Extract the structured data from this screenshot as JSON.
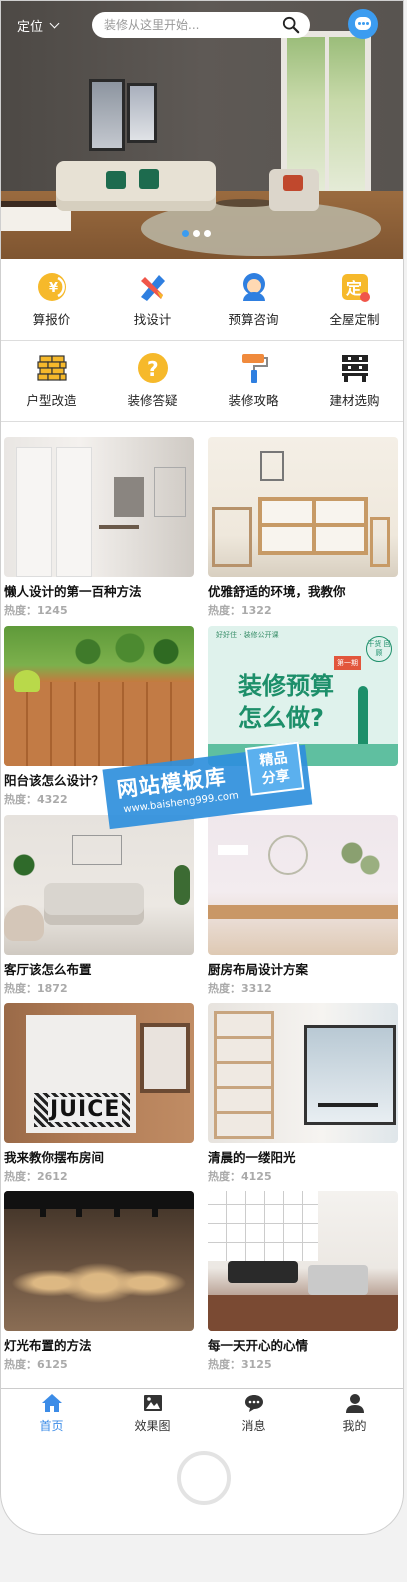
{
  "header": {
    "location_label": "定位",
    "search_placeholder": "装修从这里开始..."
  },
  "hero": {
    "slides": 3,
    "active_slide": 1
  },
  "quick_menu_row1": [
    {
      "label": "算报价",
      "icon": "yen-coin-icon"
    },
    {
      "label": "找设计",
      "icon": "ruler-pencil-icon"
    },
    {
      "label": "预算咨询",
      "icon": "consultant-avatar-icon"
    },
    {
      "label": "全屋定制",
      "icon": "custom-stamp-icon"
    }
  ],
  "quick_menu_row2": [
    {
      "label": "户型改造",
      "icon": "brick-wall-icon"
    },
    {
      "label": "装修答疑",
      "icon": "question-icon"
    },
    {
      "label": "装修攻略",
      "icon": "paint-roller-icon"
    },
    {
      "label": "建材选购",
      "icon": "materials-shelf-icon"
    }
  ],
  "articles": [
    {
      "title": "懒人设计的第一百种方法",
      "heat": "热度：1245"
    },
    {
      "title": "优雅舒适的环境，我教你",
      "heat": "热度：1322"
    },
    {
      "title": "阳台该怎么设计？",
      "heat": "热度：4322"
    },
    {
      "title": "",
      "heat": ""
    },
    {
      "title": "客厅该怎么布置",
      "heat": "热度：1872"
    },
    {
      "title": "厨房布局设计方案",
      "heat": "热度：3312"
    },
    {
      "title": "我来教你摆布房间",
      "heat": "热度：2612"
    },
    {
      "title": "清晨的一缕阳光",
      "heat": "热度：4125"
    },
    {
      "title": "灯光布置的方法",
      "heat": "热度：6125"
    },
    {
      "title": "每一天开心的心情",
      "heat": "热度：3125"
    }
  ],
  "promo_card": {
    "brand": "好好住 · 装修公开课",
    "headline_1": "装修预算",
    "headline_2": "怎么做?",
    "badge_1": "第一期",
    "badge_2": "干货 回顾"
  },
  "juice_text": "JUICE",
  "watermark": {
    "title": "网站模板库",
    "url": "www.baisheng999.com",
    "tag_1": "精品",
    "tag_2": "分享"
  },
  "tabbar": [
    {
      "label": "首页",
      "icon": "home-icon",
      "active": true
    },
    {
      "label": "效果图",
      "icon": "image-icon",
      "active": false
    },
    {
      "label": "消息",
      "icon": "message-icon",
      "active": false
    },
    {
      "label": "我的",
      "icon": "user-icon",
      "active": false
    }
  ],
  "colors": {
    "accent": "#3c9cf0",
    "icon_yellow": "#f6b92b",
    "active_tab": "#3c8ce7"
  }
}
